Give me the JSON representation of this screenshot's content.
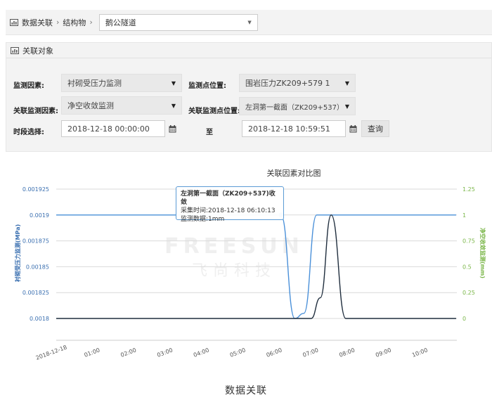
{
  "breadcrumb": {
    "items": [
      "数据关联",
      "结构物"
    ],
    "separator": "›",
    "select_value": "鹅公隧道"
  },
  "panel": {
    "title": "关联对象",
    "monitor_factor_label": "监测因素:",
    "monitor_factor_value": "衬砌受压力监测",
    "point_label": "监测点位置:",
    "point_value": "围岩压力ZK209+579 1",
    "rel_factor_label": "关联监测因素:",
    "rel_factor_value": "净空收敛监测",
    "rel_point_label": "关联监测点位置:",
    "rel_point_value": "左洞第一截面（ZK209+537）",
    "period_label": "时段选择:",
    "start_time": "2018-12-18 00:00:00",
    "to_label": "至",
    "end_time": "2018-12-18 10:59:51",
    "query_label": "查询"
  },
  "tooltip": {
    "title": "左洞第一截面（ZK209+537)收敛",
    "time": "采集时间:2018-12-18 06:10:13",
    "value": "监测数据:1mm"
  },
  "watermark": {
    "en": "FREESUN",
    "cn": "飞尚科技"
  },
  "caption": "数据关联",
  "colors": {
    "series_a": "#4a90d9",
    "series_b": "#1f2d3d",
    "grid": "#d9d9d9",
    "right_axis": "#7ab648"
  },
  "chart_data": {
    "type": "line",
    "title": "关联因素对比图",
    "ylabel_left": "衬砌受压力监测(MPa)",
    "ylabel_right": "净空收敛监测(mm)",
    "x_ticks": [
      "2018-12-18",
      "01:00",
      "02:00",
      "03:00",
      "04:00",
      "05:00",
      "06:00",
      "07:00",
      "08:00",
      "09:00",
      "10:00"
    ],
    "y_left_ticks": [
      "0.001925",
      "0.0019",
      "0.001875",
      "0.00185",
      "0.001825",
      "0.0018"
    ],
    "y_right_ticks": [
      "1.25",
      "1",
      "0.75",
      "0.5",
      "0.25",
      "0"
    ],
    "ylim_left": [
      0.0018,
      0.001925
    ],
    "ylim_right": [
      0,
      1.25
    ],
    "xlim_hours": [
      0,
      11
    ],
    "series": [
      {
        "axis": "right",
        "x_hours": [
          0,
          6.17,
          6.55,
          6.8,
          7.15,
          10.98
        ],
        "values": [
          1,
          1,
          0,
          0.05,
          1,
          1
        ]
      },
      {
        "axis": "left",
        "x_hours": [
          0,
          7.0,
          7.25,
          7.55,
          7.95,
          10.98
        ],
        "values": [
          0.0018,
          0.0018,
          0.00182,
          0.0019,
          0.0018,
          0.0018
        ]
      }
    ],
    "highlight": {
      "series": 0,
      "x_hours": 6.17,
      "value": 1
    },
    "grid": true
  }
}
